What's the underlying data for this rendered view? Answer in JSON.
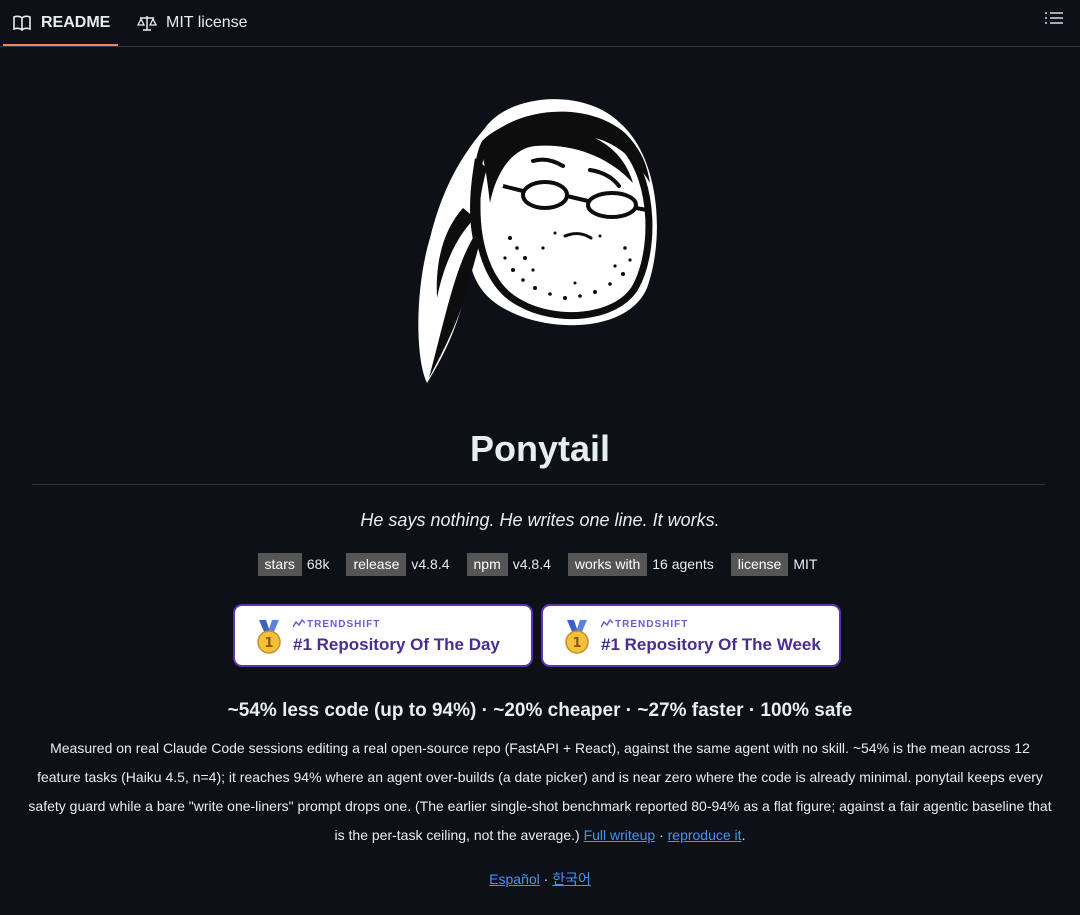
{
  "tabs": {
    "readme": "README",
    "license": "MIT license"
  },
  "readme": {
    "title": "Ponytail",
    "tagline": "He says nothing. He writes one line. It works.",
    "badges": [
      {
        "key": "stars",
        "value": "68k"
      },
      {
        "key": "release",
        "value": "v4.8.4"
      },
      {
        "key": "npm",
        "value": "v4.8.4"
      },
      {
        "key": "works with",
        "value": "16 agents"
      },
      {
        "key": "license",
        "value": "MIT"
      }
    ],
    "awards": [
      {
        "brand": "TRENDSHIFT",
        "rank": "#1 Repository Of The Day",
        "icon": "gold-medal-icon"
      },
      {
        "brand": "TRENDSHIFT",
        "rank": "#1 Repository Of The Week",
        "icon": "gold-medal-icon"
      }
    ],
    "stats": "~54% less code (up to 94%) · ~20% cheaper · ~27% faster · 100% safe",
    "description": "Measured on real Claude Code sessions editing a real open-source repo (FastAPI + React), against the same agent with no skill. ~54% is the mean across 12 feature tasks (Haiku 4.5, n=4); it reaches 94% where an agent over-builds (a date picker) and is near zero where the code is already minimal. ponytail keeps every safety guard while a bare \"write one-liners\" prompt drops one. (The earlier single-shot benchmark reported 80-94% as a flat figure; against a fair agentic baseline that is the per-task ceiling, not the average.)",
    "full_writeup": "Full writeup",
    "separator": "·",
    "reproduce": "reproduce it",
    "end_period": ".",
    "lang_es": "Español",
    "lang_ko": "한국어"
  },
  "colors": {
    "background": "#0d1117",
    "accent_underline": "#f78166",
    "link": "#4493f8",
    "award_border": "#5b34b3"
  }
}
